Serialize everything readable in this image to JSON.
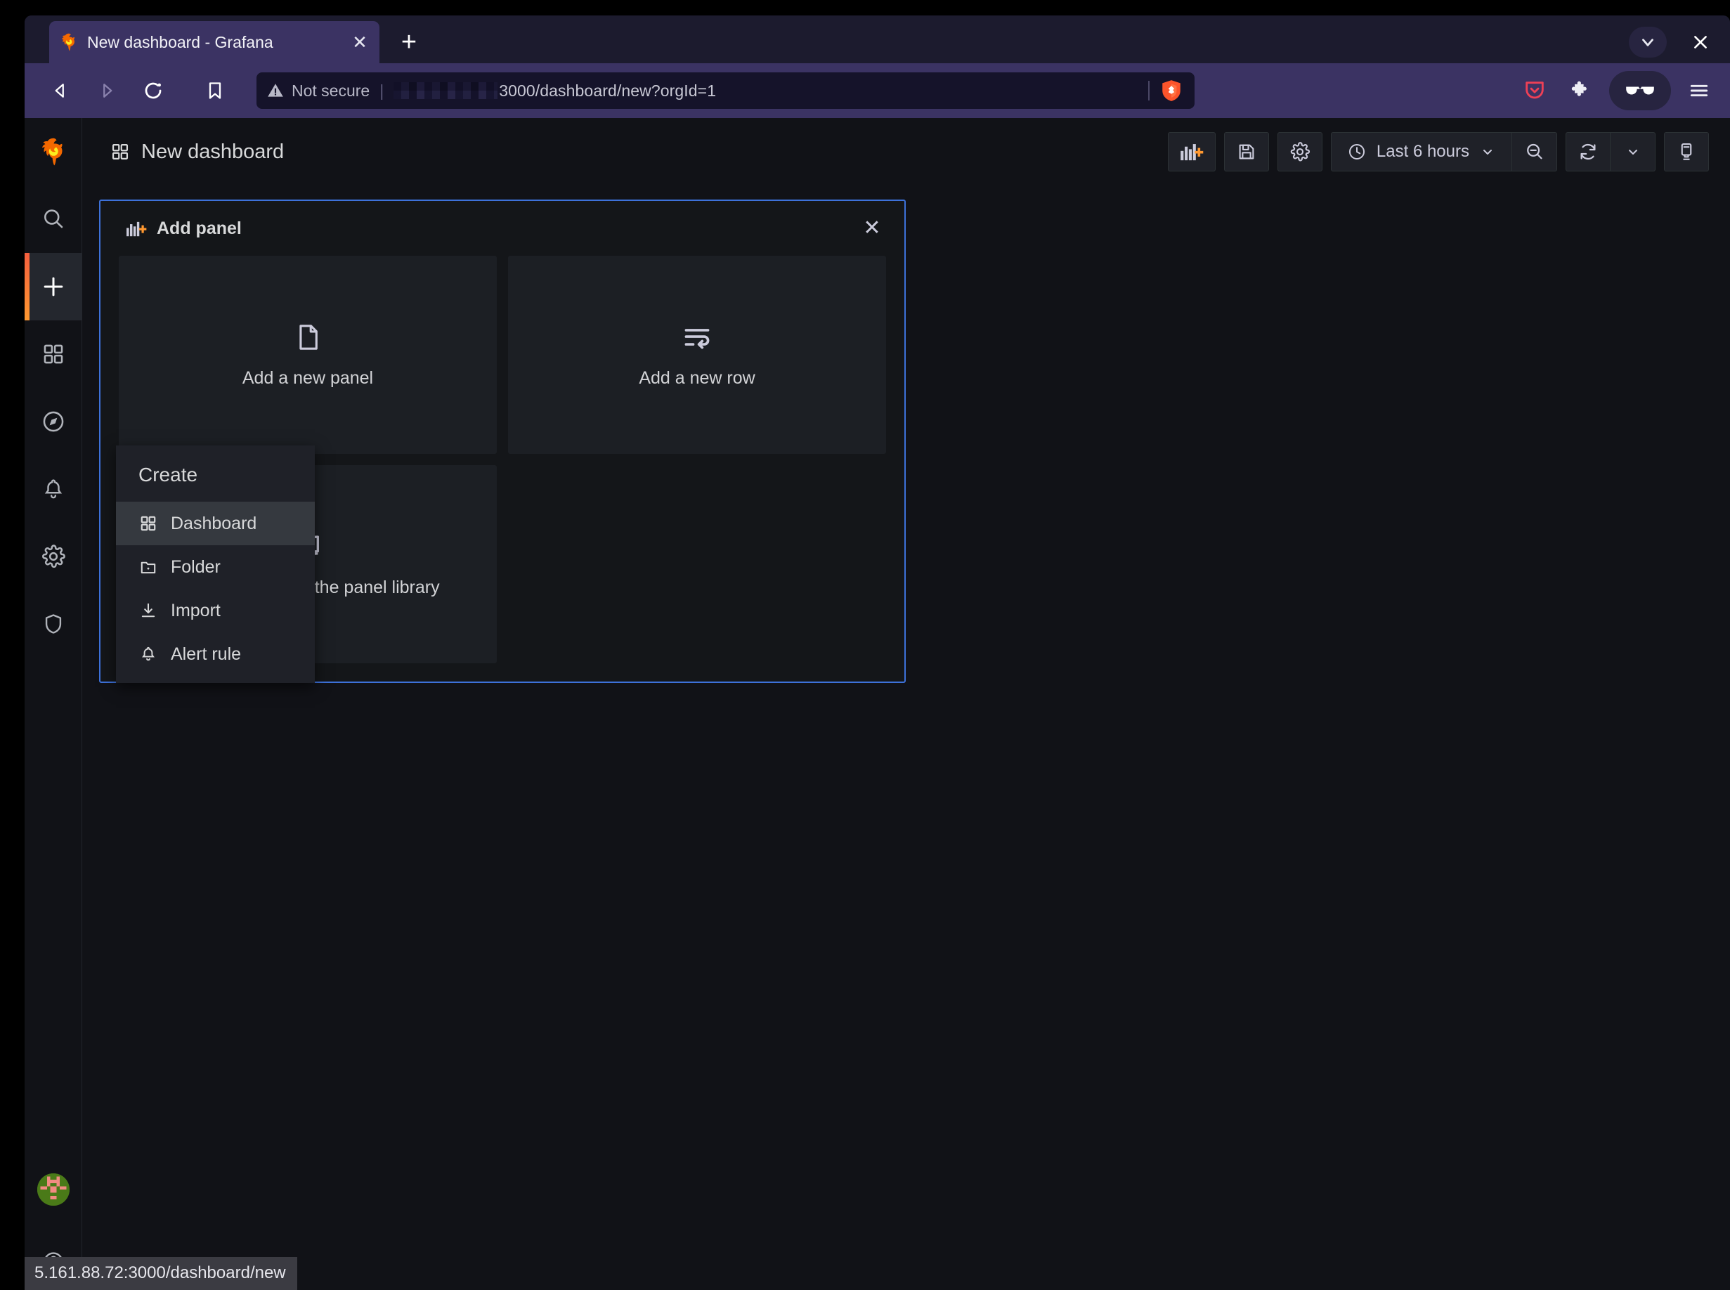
{
  "browser": {
    "tab": {
      "title": "New dashboard - Grafana",
      "favicon_icon": "grafana-logo-icon",
      "close_icon": "close-icon"
    },
    "new_tab_label": "+",
    "tab_list_icon": "chevron-down-icon",
    "window_close_icon": "close-icon",
    "nav": {
      "back_icon": "back-arrow-icon",
      "forward_icon": "forward-arrow-icon",
      "reload_icon": "reload-icon",
      "bookmark_icon": "bookmark-icon"
    },
    "url": {
      "security_icon": "warning-triangle-icon",
      "security_label": "Not secure",
      "separator": "|",
      "host_redacted": true,
      "text": "3000/dashboard/new?orgId=1",
      "shield_icon": "brave-shield-icon"
    },
    "toolbar": {
      "pocket_icon": "pocket-icon",
      "extensions_icon": "extensions-puzzle-icon",
      "private_icon": "private-glasses-icon",
      "menu_icon": "hamburger-menu-icon"
    }
  },
  "grafana": {
    "sidebar": {
      "logo_icon": "grafana-logo-icon",
      "items": [
        {
          "name": "search",
          "icon": "search-icon",
          "active": false
        },
        {
          "name": "create",
          "icon": "plus-icon",
          "active": true
        },
        {
          "name": "dashboards",
          "icon": "apps-grid-icon",
          "active": false
        },
        {
          "name": "explore",
          "icon": "compass-icon",
          "active": false
        },
        {
          "name": "alerting",
          "icon": "bell-icon",
          "active": false
        },
        {
          "name": "configuration",
          "icon": "gear-icon",
          "active": false
        },
        {
          "name": "server-admin",
          "icon": "shield-icon",
          "active": false
        }
      ],
      "avatar_icon": "user-avatar",
      "help_icon": "question-circle-icon"
    },
    "header": {
      "breadcrumb_icon": "apps-grid-icon",
      "title": "New dashboard"
    },
    "toolbar": {
      "add_panel_icon": "add-panel-icon",
      "save_icon": "save-floppy-icon",
      "settings_icon": "gear-icon",
      "time_clock_icon": "clock-icon",
      "time_range": "Last 6 hours",
      "time_chevron_icon": "chevron-down-icon",
      "zoom_out_icon": "zoom-out-icon",
      "refresh_icon": "refresh-icon",
      "refresh_chevron_icon": "chevron-down-icon",
      "kiosk_icon": "tv-kiosk-icon"
    },
    "add_panel": {
      "icon": "add-panel-icon",
      "title": "Add panel",
      "close_icon": "close-icon",
      "cards": [
        {
          "label": "Add a new panel",
          "icon": "file-plus-icon"
        },
        {
          "label": "Add a new row",
          "icon": "wrap-text-icon"
        },
        {
          "label": "Add a panel from the panel library",
          "icon": "book-open-icon"
        }
      ]
    },
    "create_menu": {
      "title": "Create",
      "items": [
        {
          "label": "Dashboard",
          "icon": "apps-grid-icon",
          "active": true
        },
        {
          "label": "Folder",
          "icon": "folder-plus-icon",
          "active": false
        },
        {
          "label": "Import",
          "icon": "import-download-icon",
          "active": false
        },
        {
          "label": "Alert rule",
          "icon": "bell-icon",
          "active": false
        }
      ]
    }
  },
  "status_bar": {
    "url": "5.161.88.72:3000/dashboard/new"
  },
  "colors": {
    "brand_orange": "#ff9830",
    "accent_blue": "#3d71d9",
    "browser_chrome": "#3b3363",
    "app_bg": "#111217",
    "panel_bg": "#141619",
    "card_bg": "#1c1f24"
  }
}
